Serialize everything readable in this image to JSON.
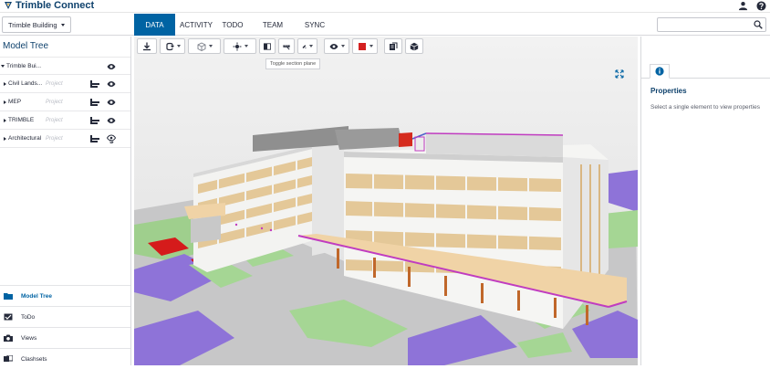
{
  "app": {
    "name": "Trimble Connect",
    "brand_color": "#0e416c",
    "accent_color": "#0063a3"
  },
  "header": {
    "icons": [
      "user-icon",
      "help-icon"
    ]
  },
  "project": {
    "name": "Trimble Building"
  },
  "tabs": [
    {
      "label": "DATA",
      "active": true
    },
    {
      "label": "ACTIVITY",
      "active": false
    },
    {
      "label": "TODO",
      "active": false
    },
    {
      "label": "TEAM",
      "active": false
    },
    {
      "label": "SYNC",
      "active": false
    }
  ],
  "search": {
    "placeholder": "",
    "value": ""
  },
  "left_panel": {
    "title": "Model Tree",
    "tree": [
      {
        "label": "Trimble Bui...",
        "tag": "",
        "expanded": true
      },
      {
        "label": "Civil Lands...",
        "tag": "Project"
      },
      {
        "label": "MEP",
        "tag": "Project"
      },
      {
        "label": "TRIMBLE",
        "tag": "Project"
      },
      {
        "label": "Architectural",
        "tag": "Project"
      }
    ],
    "nav": [
      {
        "label": "Model Tree",
        "icon": "folder-icon",
        "active": true
      },
      {
        "label": "ToDo",
        "icon": "todo-icon",
        "active": false
      },
      {
        "label": "Views",
        "icon": "camera-icon",
        "active": false
      },
      {
        "label": "Clashsets",
        "icon": "clash-icon",
        "active": false
      }
    ]
  },
  "viewer": {
    "toolbar": [
      "download-icon",
      "orbit-icon",
      "view-cube-icon",
      "selection-icon",
      "section-plane-icon",
      "measure-icon",
      "markup-icon",
      "visibility-icon",
      "color-icon",
      "model-icon",
      "object-icon"
    ],
    "tooltip": "Toggle section plane"
  },
  "right_panel": {
    "title": "Properties",
    "hint": "Select a single element to view properties"
  }
}
